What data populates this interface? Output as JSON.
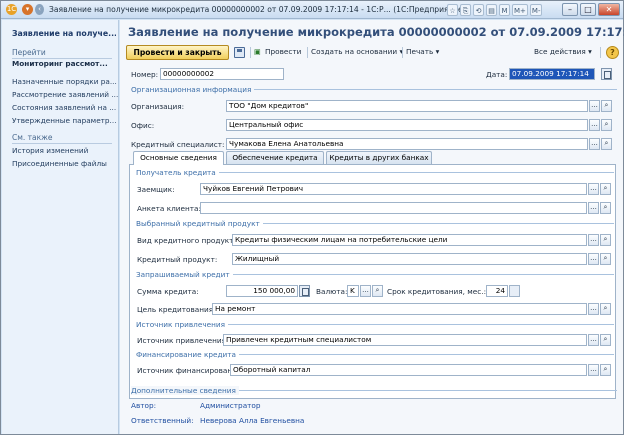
{
  "window": {
    "title": "Заявление на получение микрокредита 00000000002 от 07.09.2009 17:17:14 - 1С:Р...  (1С:Предприятие)",
    "tools": [
      "M",
      "M+",
      "M-"
    ],
    "buttons": {
      "minimize": "–",
      "restore": "□",
      "close": "✕"
    }
  },
  "sidebar": {
    "title": "Заявление на получе...",
    "goto_header": "Перейти",
    "items": [
      "Мониторинг рассмот...",
      "Назначенные порядки ра...",
      "Рассмотрение заявлений ...",
      "Состояния заявлений на ...",
      "Утвержденные параметр..."
    ],
    "see_also_header": "См. также",
    "see_also": [
      "История изменений",
      "Присоединенные файлы"
    ]
  },
  "document": {
    "title": "Заявление на получение микрокредита 00000000002 от 07.09.2009 17:17:14"
  },
  "toolbar": {
    "post_close": "Провести и закрыть",
    "post": "Провести",
    "create_based": "Создать на основании",
    "print": "Печать",
    "all_actions": "Все действия",
    "help": "?"
  },
  "header_fields": {
    "number_label": "Номер:",
    "number_value": "00000000002",
    "date_label": "Дата:",
    "date_value": "07.09.2009 17:17:14"
  },
  "org_info": {
    "group": "Организационная информация",
    "organization_label": "Организация:",
    "organization_value": "ТОО \"Дом кредитов\"",
    "office_label": "Офис:",
    "office_value": "Центральный офис",
    "specialist_label": "Кредитный специалист:",
    "specialist_value": "Чумакова Елена Анатольевна"
  },
  "tabs": [
    "Основные сведения",
    "Обеспечение кредита",
    "Кредиты в других банках"
  ],
  "recipient": {
    "group": "Получатель кредита",
    "borrower_label": "Заемщик:",
    "borrower_value": "Чуйков Евгений Петрович",
    "form_label": "Анкета клиента:",
    "form_value": ""
  },
  "product": {
    "group": "Выбранный кредитный продукт",
    "type_label": "Вид кредитного продукта:",
    "type_value": "Кредиты физическим лицам на потребительские цели",
    "product_label": "Кредитный продукт:",
    "product_value": "Жилищный"
  },
  "requested": {
    "group": "Запрашиваемый кредит",
    "sum_label": "Сумма кредита:",
    "sum_value": "150 000,00",
    "currency_label": "Валюта:",
    "currency_value": "K",
    "term_label": "Срок кредитования, мес.:",
    "term_value": "24",
    "purpose_label": "Цель кредитования:",
    "purpose_value": "На ремонт"
  },
  "source": {
    "group": "Источник привлечения",
    "label": "Источник привлечения:",
    "value": "Привлечен кредитным специалистом"
  },
  "financing": {
    "group": "Финансирование кредита",
    "label": "Источник финансирования:",
    "value": "Оборотный капитал"
  },
  "extra": {
    "group": "Дополнительные сведения",
    "author_label": "Автор:",
    "author_value": "Администратор",
    "responsible_label": "Ответственный:",
    "responsible_value": "Неверова Алла Евгеньевна"
  },
  "colors": {
    "accent": "#334f7a",
    "primary_button": "#f1cf5c",
    "selection": "#1e56b8"
  }
}
